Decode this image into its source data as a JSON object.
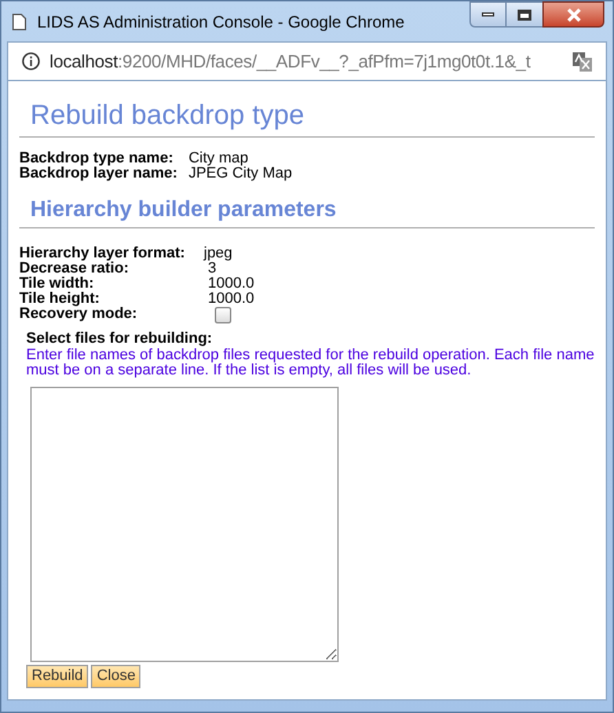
{
  "window": {
    "title": "LIDS AS Administration Console - Google Chrome"
  },
  "address_bar": {
    "host": "localhost",
    "path": ":9200/MHD/faces/__ADFv__?_afPfm=7j1mg0t0t.1&_t"
  },
  "heading": "Rebuild backdrop type",
  "info": [
    {
      "label": "Backdrop type name:",
      "value": "City map"
    },
    {
      "label": "Backdrop layer name:",
      "value": "JPEG City Map"
    }
  ],
  "section_heading": "Hierarchy builder parameters",
  "params": [
    {
      "kind": "text",
      "label": "Hierarchy layer format:",
      "value": "jpeg"
    },
    {
      "kind": "text",
      "label": "Decrease ratio:",
      "value": "3"
    },
    {
      "kind": "text",
      "label": "Tile width:",
      "value": "1000.0"
    },
    {
      "kind": "text",
      "label": "Tile height:",
      "value": "1000.0"
    },
    {
      "kind": "checkbox",
      "label": "Recovery mode:",
      "checked": false
    }
  ],
  "files": {
    "label": "Select files for rebuilding:",
    "hint": "Enter file names of backdrop files requested for the rebuild operation. Each file name must be on a separate line. If the list is empty, all files will be used."
  },
  "buttons": [
    "Rebuild",
    "Close"
  ]
}
